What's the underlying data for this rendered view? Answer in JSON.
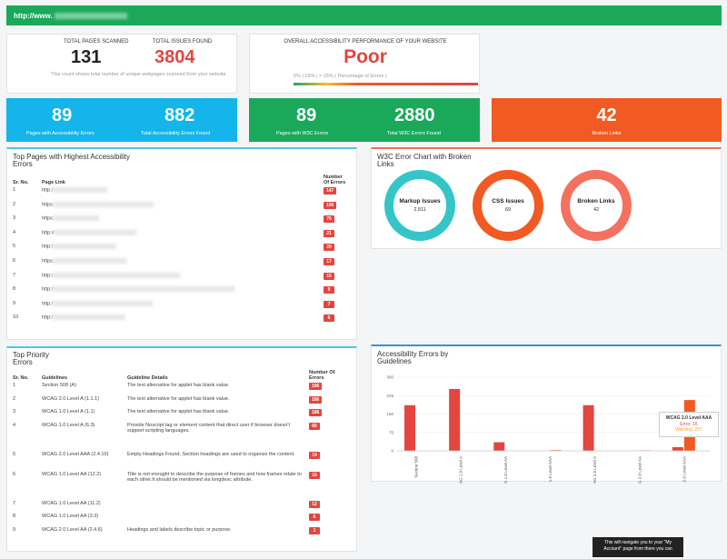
{
  "header": {
    "url_text": "http://www."
  },
  "summary": {
    "total_pages_label": "TOTAL PAGES SCANNED",
    "total_pages_value": "131",
    "total_issues_label": "TOTAL ISSUES FOUND",
    "total_issues_value": "3804",
    "note": "This count shows total number of unique webpages scanned from your website",
    "overall_label": "OVERALL ACCESSIBILITY PERFORMANCE OF YOUR WEBSITE",
    "overall_value": "Poor",
    "scale_text": "5% | 15% | > 15%     ( Percentage of Errors )"
  },
  "tiles": [
    {
      "v1": "89",
      "l1": "Pages with Accessibility Errors",
      "v2": "882",
      "l2": "Total Accessibility Errors Found",
      "color": "#13b5ea"
    },
    {
      "v1": "89",
      "l1": "Pages with W3C Errors",
      "v2": "2880",
      "l2": "Total W3C Errors Found",
      "color": "#1aa85b"
    },
    {
      "v1": "42",
      "l1": "Broken Links",
      "color": "#f15a22"
    }
  ],
  "top_pages": {
    "title_line1": "Top Pages with Highest Accessibility",
    "title_line2": "Errors",
    "col_sr": "Sr. No.",
    "col_link": "Page Link",
    "col_errors_1": "Number",
    "col_errors_2": "Of Errors",
    "rows": [
      {
        "sr": "1",
        "link": "http:/",
        "errors": "147"
      },
      {
        "sr": "2",
        "link": "https:",
        "errors": "106"
      },
      {
        "sr": "3",
        "link": "https:",
        "errors": "76"
      },
      {
        "sr": "4",
        "link": "http://",
        "errors": "21"
      },
      {
        "sr": "5",
        "link": "http:/",
        "errors": "20"
      },
      {
        "sr": "6",
        "link": "https:",
        "errors": "17"
      },
      {
        "sr": "7",
        "link": "http:/",
        "errors": "15"
      },
      {
        "sr": "8",
        "link": "http:/",
        "errors": "9"
      },
      {
        "sr": "9",
        "link": "http:/",
        "errors": "7"
      },
      {
        "sr": "10",
        "link": "http:/",
        "errors": "6"
      }
    ]
  },
  "w3c_chart": {
    "title_line1": "W3C Error Chart with Broken",
    "title_line2": "Links",
    "rings": [
      {
        "label": "Markup Issues",
        "value": "2,811",
        "color": "#35c5c9"
      },
      {
        "label": "CSS Issues",
        "value": "69",
        "color": "#f15a22"
      },
      {
        "label": "Broken Links",
        "value": "42",
        "color": "#f4705f"
      }
    ]
  },
  "priority": {
    "title_line1": "Top Priority",
    "title_line2": "Errors",
    "col_sr": "Sr. No.",
    "col_guide": "Guidelines",
    "col_details": "Guideline Details",
    "col_errors_1": "Number Of",
    "col_errors_2": "Errors",
    "rows": [
      {
        "sr": "1",
        "guide": "Section 508 (A)",
        "details": "The text alternative for applet has blank value.",
        "errors": "186"
      },
      {
        "sr": "2",
        "guide": "WCAG 2.0 Level A (1.1.1)",
        "details": "The text alternative for applet has blank value.",
        "errors": "186"
      },
      {
        "sr": "3",
        "guide": "WCAG 1.0 Level A (1.1)",
        "details": "The text alternative for applet has blank value.",
        "errors": "186"
      },
      {
        "sr": "4",
        "guide": "WCAG 1.0 Level A (6.3)",
        "details": "Provide Noscript tag or element content that direct user if browser doesn't support scripting languages.",
        "errors": "60"
      },
      {
        "sr": "5",
        "guide": "WCAG 2.0 Level AAA (2.4.10)",
        "details": "Empty Headings Found, Section headings are used to organize the content.",
        "errors": "19"
      },
      {
        "sr": "6",
        "guide": "WCAG 1.0 Level AA (12.2)",
        "details": "Title is not enought to describe the purpose of frames and how frames relate to each other.It should be mentioned via longdesc attribute.",
        "errors": "15"
      },
      {
        "sr": "7",
        "guide": "WCAG 1.0 Level AA (11.2)",
        "details": "",
        "errors": "12"
      },
      {
        "sr": "8",
        "guide": "WCAG 1.0 Level AA (3.3)",
        "details": "",
        "errors": "6"
      },
      {
        "sr": "9",
        "guide": "WCAG 2.0 Level AA (2.4.6)",
        "details": "Headings and labels describe topic or purpose.",
        "errors": "1"
      }
    ]
  },
  "guideline_chart": {
    "title_line1": "Accessibility Errors by",
    "title_line2": "Guidelines",
    "chart_data": {
      "type": "bar",
      "categories": [
        "Section 508",
        "WCAG 1.0 Level A",
        "WCAG 1.0 Level AA",
        "WCAG 1.0 Level AAA",
        "WCAG 2.0 Level A",
        "WCAG 2.0 Level AA",
        "WCAG 2.0 Level AAA"
      ],
      "series": [
        {
          "name": "Error",
          "values": [
            186,
            252,
            35,
            0,
            186,
            0,
            15
          ],
          "color": "#e2463f"
        },
        {
          "name": "Warning",
          "values": [
            0,
            0,
            0,
            3,
            0,
            2,
            207
          ],
          "color": "#f15a22"
        }
      ],
      "yticks": [
        "0",
        "75",
        "150",
        "225",
        "300"
      ],
      "ylim": [
        0,
        300
      ],
      "tooltip": {
        "title": "WCAG 2.0 Level AAA",
        "error": "Error: 15",
        "warning": "Warning: 207"
      }
    }
  },
  "tooltip_text": "This will navigate you to your \"My Account\" page from there you can"
}
